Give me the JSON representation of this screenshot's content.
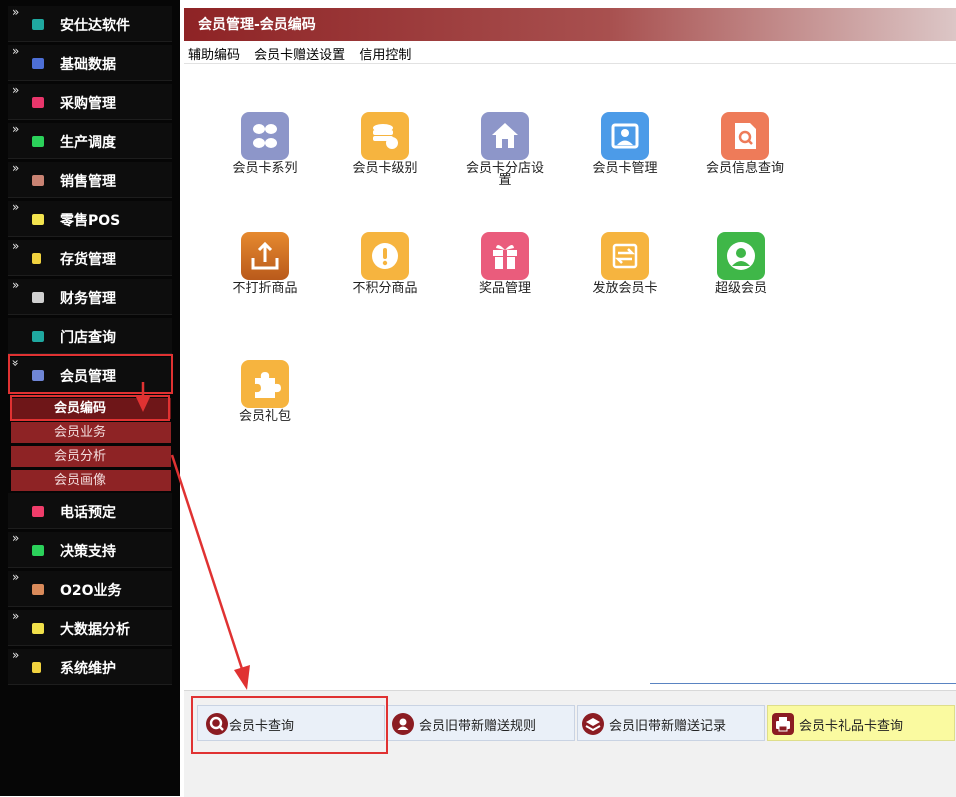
{
  "sidebar": {
    "items": [
      {
        "label": "安仕达软件",
        "chevron": "»",
        "icon": "teal-square-icon",
        "color": "#1fa8a0"
      },
      {
        "label": "基础数据",
        "chevron": "»",
        "icon": "blue-square-icon",
        "color": "#4d6fd6"
      },
      {
        "label": "采购管理",
        "chevron": "»",
        "icon": "red-square-icon",
        "color": "#e8366b"
      },
      {
        "label": "生产调度",
        "chevron": "»",
        "icon": "green-square-icon",
        "color": "#2bd15a"
      },
      {
        "label": "销售管理",
        "chevron": "»",
        "icon": "brown-square-icon",
        "color": "#c98373"
      },
      {
        "label": "零售POS",
        "chevron": "»",
        "icon": "yellow-square-icon",
        "color": "#f2e34e"
      },
      {
        "label": "存货管理",
        "chevron": "»",
        "icon": "yellow-note-icon",
        "color": "#f0d23f"
      },
      {
        "label": "财务管理",
        "chevron": "»",
        "icon": "gray-square-icon",
        "color": "#d0d0d0"
      },
      {
        "label": "门店查询",
        "chevron": "",
        "icon": "teal-square-icon",
        "color": "#1fa8a0"
      },
      {
        "label": "会员管理",
        "chevron": "»",
        "icon": "blue-square-icon",
        "color": "#6f86d6"
      },
      {
        "label": "电话预定",
        "chevron": "",
        "icon": "pink-square-icon",
        "color": "#ef3d6a"
      },
      {
        "label": "决策支持",
        "chevron": "»",
        "icon": "green-square-icon",
        "color": "#2bd15a"
      },
      {
        "label": "O2O业务",
        "chevron": "»",
        "icon": "brown-square-icon",
        "color": "#d98a5a"
      },
      {
        "label": "大数据分析",
        "chevron": "»",
        "icon": "yellow-square-icon",
        "color": "#f0e04a"
      },
      {
        "label": "系统维护",
        "chevron": "»",
        "icon": "yellow-note-icon",
        "color": "#f0d23f"
      }
    ],
    "sub_items": [
      {
        "label": "会员编码",
        "active": true
      },
      {
        "label": "会员业务"
      },
      {
        "label": "会员分析"
      },
      {
        "label": "会员画像"
      }
    ]
  },
  "header": {
    "title": "会员管理-会员编码"
  },
  "subnav": [
    "辅助编码",
    "会员卡赠送设置",
    "信用控制"
  ],
  "tiles": [
    {
      "label": "会员卡系列",
      "icon": "grid-icon",
      "color": "#8d96c9"
    },
    {
      "label": "会员卡级别",
      "icon": "coins-icon",
      "color": "#f6b43f"
    },
    {
      "label": "会员卡分店设置",
      "icon": "house-icon",
      "color": "#8d96c9"
    },
    {
      "label": "会员卡管理",
      "icon": "member-card-icon",
      "color": "#4c9be8"
    },
    {
      "label": "会员信息查询",
      "icon": "document-search-icon",
      "color": "#ee7b59"
    },
    {
      "label": "不打折商品",
      "icon": "export-icon",
      "color": "#d1772a"
    },
    {
      "label": "不积分商品",
      "icon": "exclamation-icon",
      "color": "#f6b43f"
    },
    {
      "label": "奖品管理",
      "icon": "gift-icon",
      "color": "#ea5c7c"
    },
    {
      "label": "发放会员卡",
      "icon": "exchange-icon",
      "color": "#f6b43f"
    },
    {
      "label": "超级会员",
      "icon": "user-circle-icon",
      "color": "#3fb748"
    },
    {
      "label": "会员礼包",
      "icon": "puzzle-icon",
      "color": "#f6b43f"
    }
  ],
  "quick_buttons": [
    {
      "label": "会员卡查询",
      "icon": "search-icon",
      "bg": "#eaf0f8"
    },
    {
      "label": "会员旧带新赠送规则",
      "icon": "user-badge-icon",
      "bg": "#eaf0f8"
    },
    {
      "label": "会员旧带新赠送记录",
      "icon": "layers-icon",
      "bg": "#eaf0f8"
    },
    {
      "label": "会员卡礼品卡查询",
      "icon": "printer-icon",
      "bg": "#fafaa0"
    }
  ],
  "colors": {
    "accent": "#8e2325",
    "highlight": "#e03232",
    "sidebar": "#060606"
  }
}
